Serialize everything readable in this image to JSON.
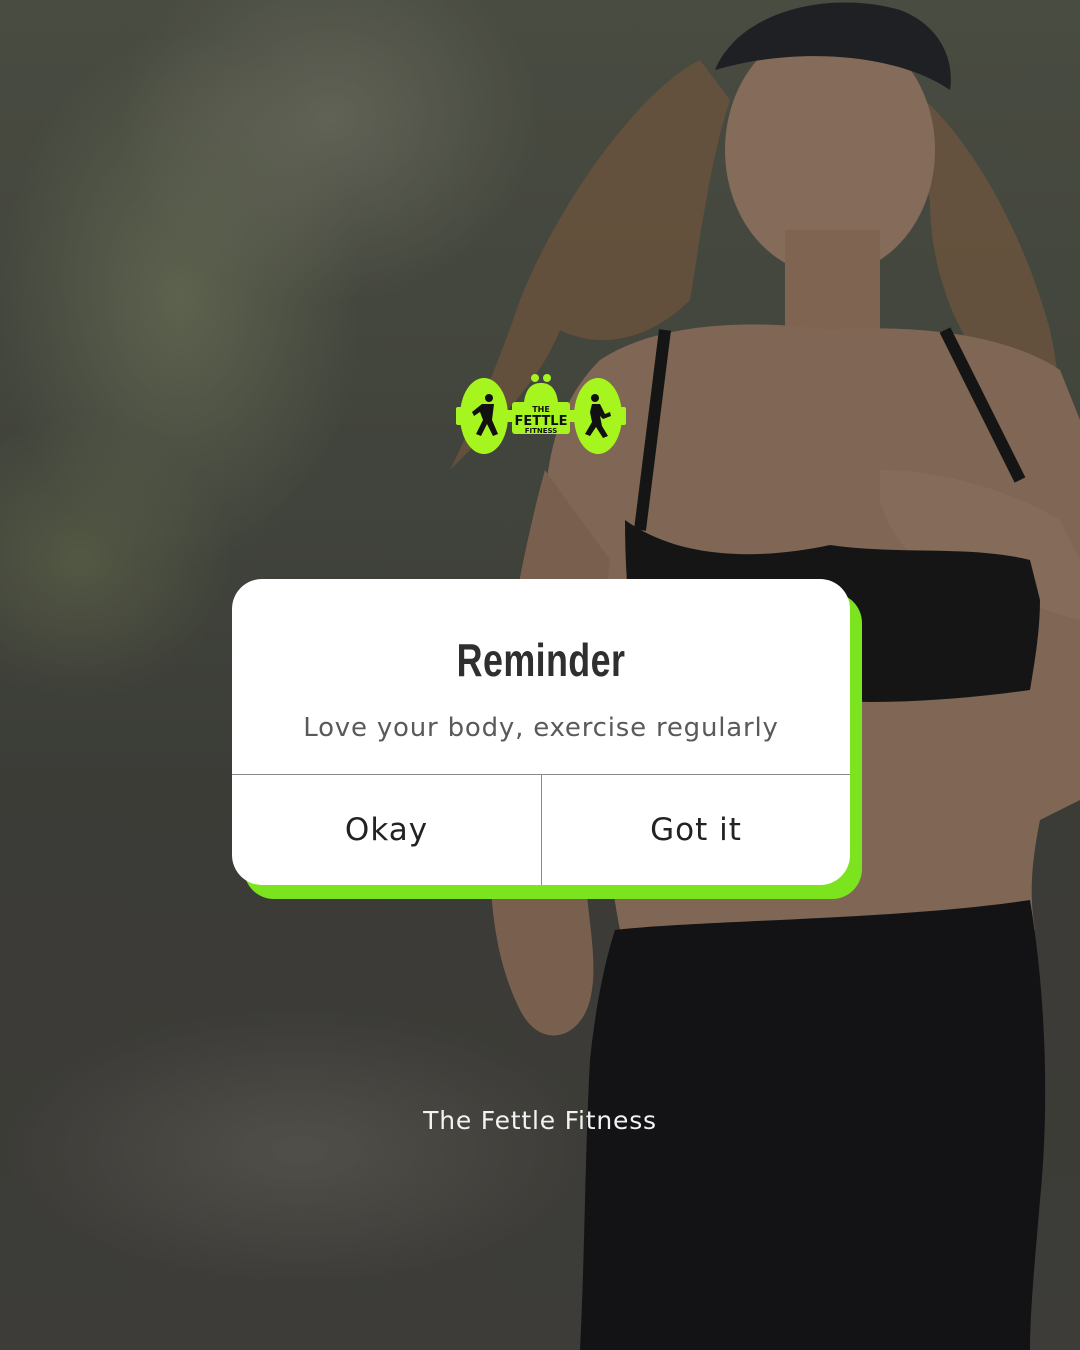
{
  "logo": {
    "line1": "THE",
    "line2": "FETTLE",
    "line3": "FITNESS",
    "color": "#a6f51f"
  },
  "dialog": {
    "title": "Reminder",
    "message": "Love your body, exercise regularly",
    "buttons": [
      {
        "label": "Okay"
      },
      {
        "label": "Got it"
      }
    ],
    "accent_color": "#7ce41e"
  },
  "footer": {
    "brand": "The Fettle Fitness"
  }
}
